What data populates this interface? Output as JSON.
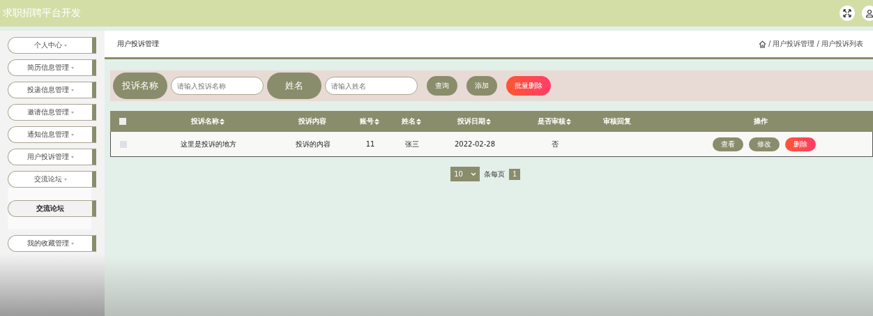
{
  "header": {
    "title": "求职招聘平台开发"
  },
  "sidebar": {
    "items": [
      {
        "label": "个人中心"
      },
      {
        "label": "简历信息管理"
      },
      {
        "label": "投递信息管理"
      },
      {
        "label": "邀请信息管理"
      },
      {
        "label": "通知信息管理"
      },
      {
        "label": "用户投诉管理"
      },
      {
        "label": "交流论坛",
        "children": [
          {
            "label": "交流论坛"
          }
        ]
      },
      {
        "label": "我的收藏管理"
      }
    ]
  },
  "page_title": "用户投诉管理",
  "breadcrumb": [
    "/ 用户投诉管理",
    "/ 用户投诉列表"
  ],
  "search": [
    {
      "label": "投诉名称",
      "placeholder": "请输入投诉名称"
    },
    {
      "label": "姓名",
      "placeholder": "请输入姓名"
    }
  ],
  "actions": [
    {
      "label": "查询",
      "kind": "normal"
    },
    {
      "label": "添加",
      "kind": "normal"
    },
    {
      "label": "批量删除",
      "kind": "danger"
    }
  ],
  "table": {
    "columns": [
      {
        "label": "投诉名称",
        "sortable": true
      },
      {
        "label": "投诉内容",
        "sortable": false
      },
      {
        "label": "账号",
        "sortable": true
      },
      {
        "label": "姓名",
        "sortable": true
      },
      {
        "label": "投诉日期",
        "sortable": true
      },
      {
        "label": "是否审核",
        "sortable": true
      },
      {
        "label": "审核回复",
        "sortable": false
      },
      {
        "label": "操作",
        "sortable": false
      }
    ],
    "header_checked": false,
    "rows": [
      {
        "checked": false,
        "cells": [
          "这里是投诉的地方",
          "投诉的内容",
          "11",
          "张三",
          "2022-02-28",
          "否",
          ""
        ],
        "buttons": [
          {
            "label": "查看",
            "kind": "normal"
          },
          {
            "label": "修改",
            "kind": "normal"
          },
          {
            "label": "删除",
            "kind": "danger"
          }
        ]
      }
    ]
  },
  "pagination": {
    "page_size": "10",
    "unit": "条每页",
    "pages": [
      {
        "label": "1",
        "selected": true
      }
    ]
  }
}
